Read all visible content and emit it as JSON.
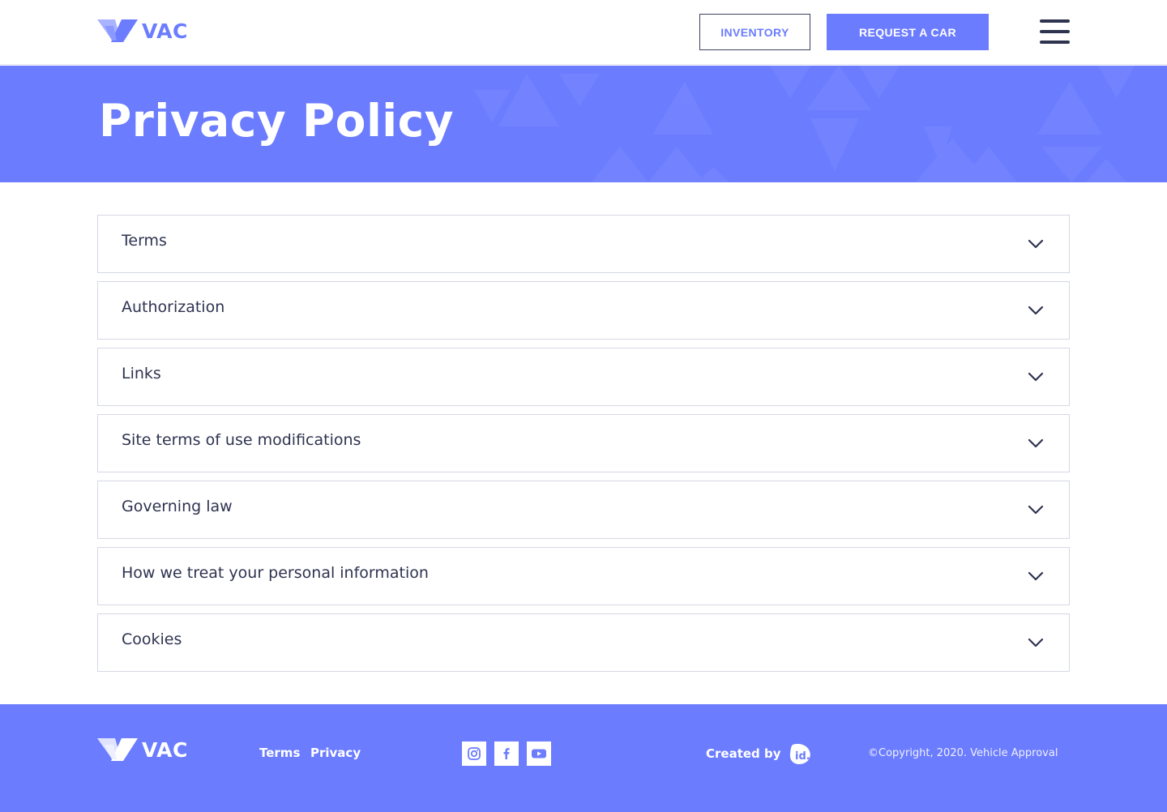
{
  "header": {
    "logo_text": "VAC",
    "inventory_label": "INVENTORY",
    "request_label": "REQUEST A CAR",
    "menu_icon": "hamburger-menu-icon"
  },
  "hero": {
    "title": "Privacy Policy"
  },
  "accordion": {
    "items": [
      {
        "label": "Terms"
      },
      {
        "label": "Authorization"
      },
      {
        "label": "Links"
      },
      {
        "label": "Site terms of use modifications"
      },
      {
        "label": "Governing law"
      },
      {
        "label": "How we treat your personal information"
      },
      {
        "label": "Cookies"
      }
    ],
    "chevron_icon": "chevron-down-icon"
  },
  "footer": {
    "logo_text": "VAC",
    "links": [
      "Terms",
      "Privacy"
    ],
    "social_icons": [
      "instagram-icon",
      "facebook-icon",
      "youtube-icon"
    ],
    "created_by": "Created by",
    "agency_logo_text": "id.",
    "copyright": "©Copyright, 2020. Vehicle Approval"
  },
  "colors": {
    "brand": "#6b7cff",
    "text_dark": "#2e3350",
    "border": "#d6d8e4",
    "white": "#ffffff"
  }
}
